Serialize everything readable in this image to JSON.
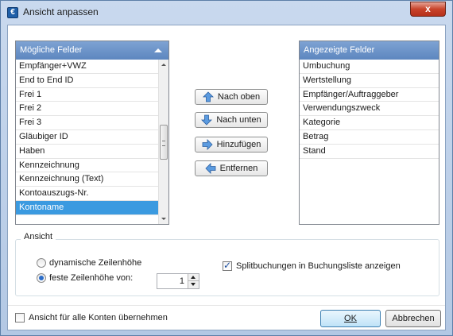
{
  "window": {
    "title": "Ansicht anpassen",
    "app_icon": "€",
    "close_glyph": "x"
  },
  "available_fields": {
    "header": "Mögliche Felder",
    "items": [
      "Empfänger+VWZ",
      "End to End ID",
      "Frei 1",
      "Frei 2",
      "Frei 3",
      "Gläubiger ID",
      "Haben",
      "Kennzeichnung",
      "Kennzeichnung (Text)",
      "Kontoauszugs-Nr.",
      "Kontoname"
    ],
    "selected": "Kontoname"
  },
  "displayed_fields": {
    "header": "Angezeigte Felder",
    "items": [
      "Umbuchung",
      "Wertstellung",
      "Empfänger/Auftraggeber",
      "Verwendungszweck",
      "Kategorie",
      "Betrag",
      "Stand"
    ]
  },
  "actions": {
    "move_up": {
      "label": "Nach oben",
      "icon": "arrow-up-icon"
    },
    "move_down": {
      "label": "Nach unten",
      "icon": "arrow-down-icon"
    },
    "add": {
      "label": "Hinzufügen",
      "icon": "arrow-right-icon"
    },
    "remove": {
      "label": "Entfernen",
      "icon": "arrow-left-icon"
    }
  },
  "view_group": {
    "legend": "Ansicht",
    "dynamic_row_height": {
      "label": "dynamische Zeilenhöhe",
      "checked": false
    },
    "fixed_row_height": {
      "label": "feste Zeilenhöhe von:",
      "checked": true
    },
    "row_height_value": "1",
    "split_bookings": {
      "label": "Splitbuchungen in Buchungsliste anzeigen",
      "checked": true
    }
  },
  "footer": {
    "apply_all": {
      "label": "Ansicht für alle Konten übernehmen",
      "checked": false
    },
    "ok_label": "OK",
    "cancel_label": "Abbrechen"
  },
  "colors": {
    "selection": "#3b9ae0",
    "header": "#6b93c9",
    "close_button": "#c8432a"
  }
}
